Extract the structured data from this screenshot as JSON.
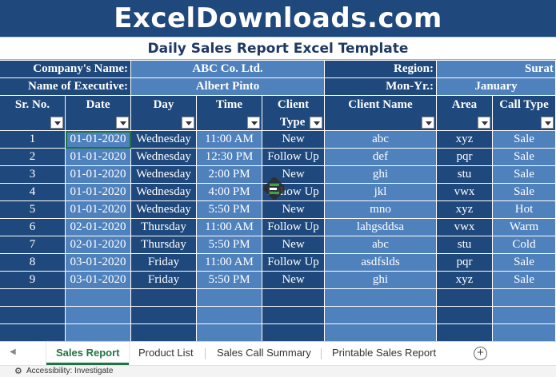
{
  "banner": {
    "site_title": "ExcelDownloads.com"
  },
  "report_title": "Daily Sales Report Excel Template",
  "info": {
    "company_label": "Company's Name:",
    "company_value": "ABC Co. Ltd.",
    "region_label": "Region:",
    "region_value": "Surat",
    "executive_label": "Name of Executive:",
    "executive_value": "Albert Pinto",
    "monyr_label": "Mon-Yr.:",
    "monyr_value": "January"
  },
  "table": {
    "headers": [
      {
        "line1": "Sr. No.",
        "line2": ""
      },
      {
        "line1": "Date",
        "line2": ""
      },
      {
        "line1": "Day",
        "line2": ""
      },
      {
        "line1": "Time",
        "line2": ""
      },
      {
        "line1": "Client",
        "line2": "Type"
      },
      {
        "line1": "Client Name",
        "line2": ""
      },
      {
        "line1": "Area",
        "line2": ""
      },
      {
        "line1": "Call Type",
        "line2": ""
      }
    ],
    "rows": [
      [
        "1",
        "01-01-2020",
        "Wednesday",
        "11:00 AM",
        "New",
        "abc",
        "xyz",
        "Sale"
      ],
      [
        "2",
        "01-01-2020",
        "Wednesday",
        "12:30 PM",
        "Follow Up",
        "def",
        "pqr",
        "Sale"
      ],
      [
        "3",
        "01-01-2020",
        "Wednesday",
        "2:00 PM",
        "New",
        "ghi",
        "stu",
        "Sale"
      ],
      [
        "4",
        "01-01-2020",
        "Wednesday",
        "4:00 PM",
        "Follow Up",
        "jkl",
        "vwx",
        "Sale"
      ],
      [
        "5",
        "01-01-2020",
        "Wednesday",
        "5:50 PM",
        "New",
        "mno",
        "xyz",
        "Hot"
      ],
      [
        "6",
        "02-01-2020",
        "Thursday",
        "11:00 AM",
        "Follow Up",
        "lahgsddsa",
        "vwx",
        "Warm"
      ],
      [
        "7",
        "02-01-2020",
        "Thursday",
        "5:50 PM",
        "New",
        "abc",
        "stu",
        "Cold"
      ],
      [
        "8",
        "03-01-2020",
        "Friday",
        "11:00 AM",
        "Follow Up",
        "asdfslds",
        "pqr",
        "Sale"
      ],
      [
        "9",
        "03-01-2020",
        "Friday",
        "5:50 PM",
        "New",
        "ghi",
        "xyz",
        "Sale"
      ],
      [
        "",
        "",
        "",
        "",
        "",
        "",
        "",
        ""
      ],
      [
        "",
        "",
        "",
        "",
        "",
        "",
        "",
        ""
      ],
      [
        "",
        "",
        "",
        "",
        "",
        "",
        "",
        ""
      ]
    ]
  },
  "sheets": {
    "tabs": [
      "Sales Report",
      "Product List",
      "Sales Call Summary",
      "Printable Sales Report"
    ],
    "active_index": 0,
    "add_label": "+"
  },
  "status": {
    "accessibility_text": "Accessibility: Investigate",
    "icon": "accessibility-icon"
  },
  "colors": {
    "dark_blue": "#1f497d",
    "light_blue": "#4f81bd",
    "excel_green": "#217346"
  }
}
